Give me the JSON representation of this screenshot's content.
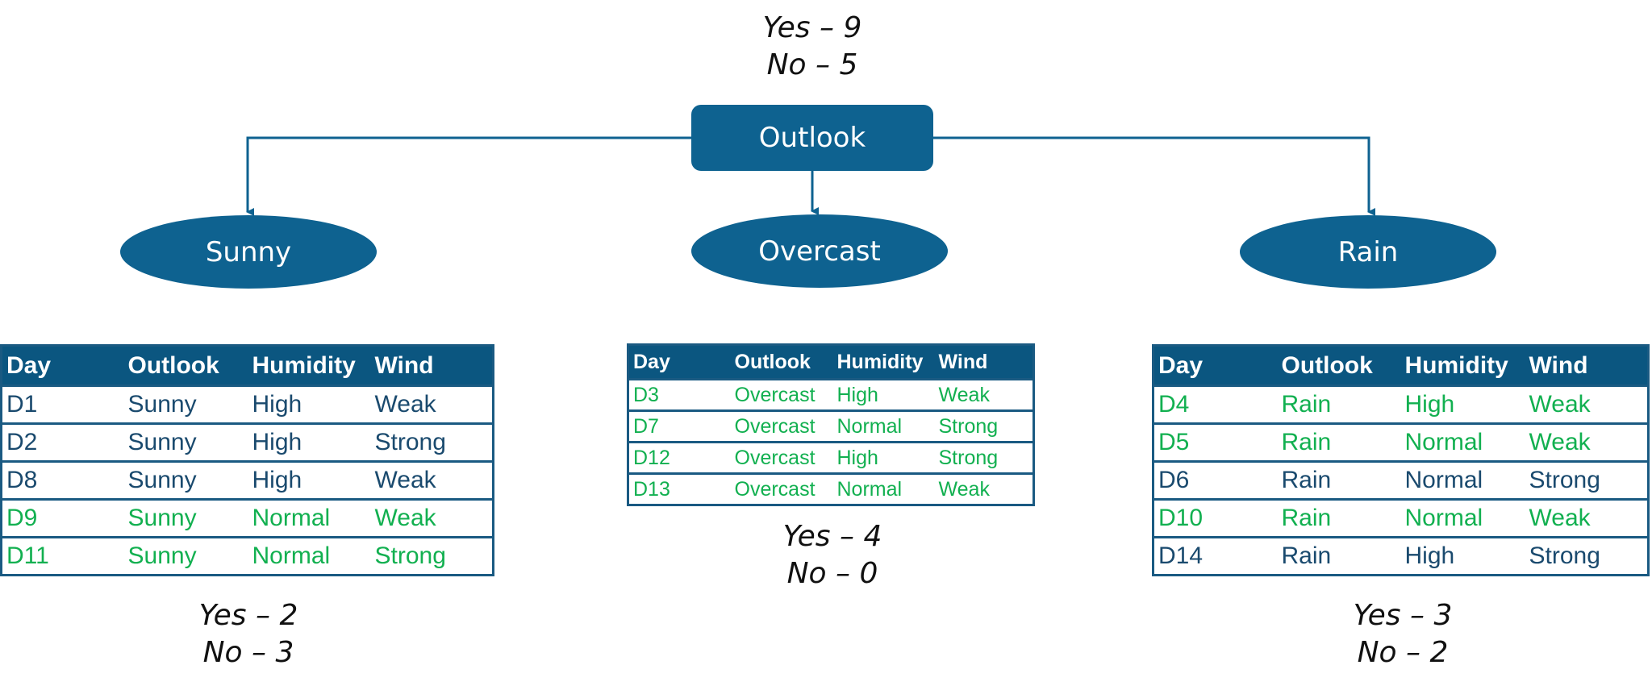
{
  "colors": {
    "node": "#0e6290",
    "header": "#0b5680",
    "yes_row": "#12b050",
    "no_row": "#1a4a6e"
  },
  "root": {
    "label": "Outlook",
    "counts": {
      "yes": "Yes – 9",
      "no": "No – 5"
    }
  },
  "columns": [
    "Day",
    "Outlook",
    "Humidity",
    "Wind"
  ],
  "branches": [
    {
      "label": "Sunny",
      "counts": {
        "yes": "Yes – 2",
        "no": "No – 3"
      },
      "rows": [
        {
          "day": "D1",
          "outlook": "Sunny",
          "humidity": "High",
          "wind": "Weak",
          "class": "no"
        },
        {
          "day": "D2",
          "outlook": "Sunny",
          "humidity": "High",
          "wind": "Strong",
          "class": "no"
        },
        {
          "day": "D8",
          "outlook": "Sunny",
          "humidity": "High",
          "wind": "Weak",
          "class": "no"
        },
        {
          "day": "D9",
          "outlook": "Sunny",
          "humidity": "Normal",
          "wind": "Weak",
          "class": "yes"
        },
        {
          "day": "D11",
          "outlook": "Sunny",
          "humidity": "Normal",
          "wind": "Strong",
          "class": "yes"
        }
      ]
    },
    {
      "label": "Overcast",
      "counts": {
        "yes": "Yes – 4",
        "no": "No – 0"
      },
      "rows": [
        {
          "day": "D3",
          "outlook": "Overcast",
          "humidity": "High",
          "wind": "Weak",
          "class": "yes"
        },
        {
          "day": "D7",
          "outlook": "Overcast",
          "humidity": "Normal",
          "wind": "Strong",
          "class": "yes"
        },
        {
          "day": "D12",
          "outlook": "Overcast",
          "humidity": "High",
          "wind": "Strong",
          "class": "yes"
        },
        {
          "day": "D13",
          "outlook": "Overcast",
          "humidity": "Normal",
          "wind": "Weak",
          "class": "yes"
        }
      ]
    },
    {
      "label": "Rain",
      "counts": {
        "yes": "Yes – 3",
        "no": "No – 2"
      },
      "rows": [
        {
          "day": "D4",
          "outlook": "Rain",
          "humidity": "High",
          "wind": "Weak",
          "class": "yes"
        },
        {
          "day": "D5",
          "outlook": "Rain",
          "humidity": "Normal",
          "wind": "Weak",
          "class": "yes"
        },
        {
          "day": "D6",
          "outlook": "Rain",
          "humidity": "Normal",
          "wind": "Strong",
          "class": "no"
        },
        {
          "day": "D10",
          "outlook": "Rain",
          "humidity": "Normal",
          "wind": "Weak",
          "class": "yes"
        },
        {
          "day": "D14",
          "outlook": "Rain",
          "humidity": "High",
          "wind": "Strong",
          "class": "no"
        }
      ]
    }
  ]
}
